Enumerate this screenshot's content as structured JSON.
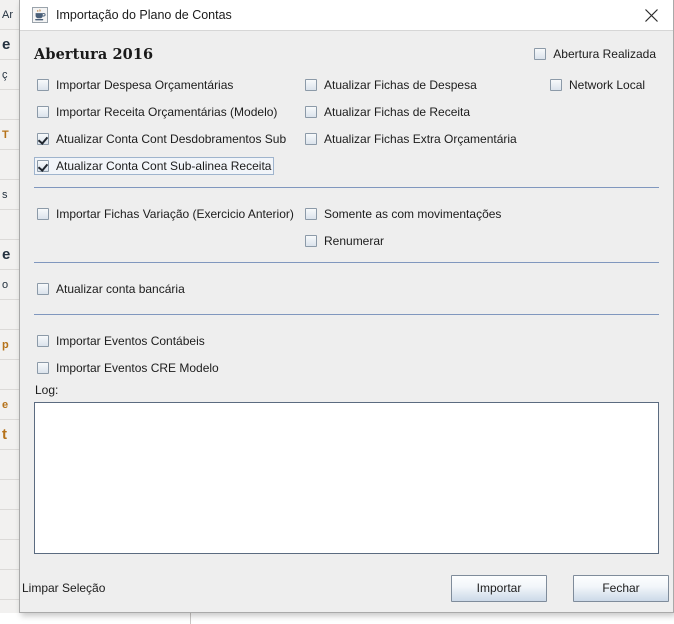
{
  "backdrop": {
    "rows": [
      "Ar",
      "e",
      "ç",
      "",
      "T",
      "",
      "s",
      "",
      "e",
      "o",
      "",
      "p",
      "",
      "e",
      "t",
      "",
      "",
      "",
      "",
      "",
      ""
    ]
  },
  "window": {
    "title": "Importação do Plano de Contas",
    "icon": "java-coffee-cup-icon",
    "close_icon": "close-icon"
  },
  "section": {
    "title": "Abertura 2016"
  },
  "options": {
    "rows": [
      {
        "left": {
          "label": "Importar Despesa Orçamentárias",
          "checked": false,
          "focused": false
        },
        "mid": {
          "label": "Atualizar Fichas de Despesa",
          "checked": false,
          "focused": false
        },
        "right": {
          "label": "Network Local",
          "checked": false,
          "focused": false
        }
      },
      {
        "left": {
          "label": "Importar Receita Orçamentárias (Modelo)",
          "checked": false,
          "focused": false
        },
        "mid": {
          "label": "Atualizar Fichas de Receita",
          "checked": false,
          "focused": false
        },
        "right": null
      },
      {
        "left": {
          "label": "Atualizar Conta Cont Desdobramentos Sub",
          "checked": true,
          "focused": false
        },
        "mid": {
          "label": "Atualizar Fichas Extra Orçamentária",
          "checked": false,
          "focused": false
        },
        "right": null
      },
      {
        "left": {
          "label": "Atualizar Conta Cont Sub-alinea Receita",
          "checked": true,
          "focused": true
        },
        "mid": null,
        "right": null
      }
    ],
    "abertura_realizada": {
      "label": "Abertura Realizada",
      "checked": false
    },
    "variacao": {
      "left": {
        "label": "Importar Fichas Variação (Exercicio Anterior)",
        "checked": false
      },
      "row1": {
        "label": "Somente as com movimentações",
        "checked": false
      },
      "row2": {
        "label": "Renumerar",
        "checked": false
      }
    },
    "bancaria": {
      "label": "Atualizar conta bancária",
      "checked": false
    },
    "eventos": [
      {
        "label": "Importar Eventos Contábeis",
        "checked": false
      },
      {
        "label": "Importar Eventos CRE Modelo",
        "checked": false
      }
    ]
  },
  "log": {
    "label": "Log:",
    "value": "",
    "placeholder": ""
  },
  "footer": {
    "clear_label": "Limpar Seleção",
    "import_label": "Importar",
    "close_label": "Fechar"
  },
  "colors": {
    "dialog_bg": "#eeeeee",
    "separator": "#5b7aad",
    "checkbox_border": "#8c9aa8",
    "focus_ring": "#9fb4cd",
    "button_border": "#7f8c9b"
  }
}
